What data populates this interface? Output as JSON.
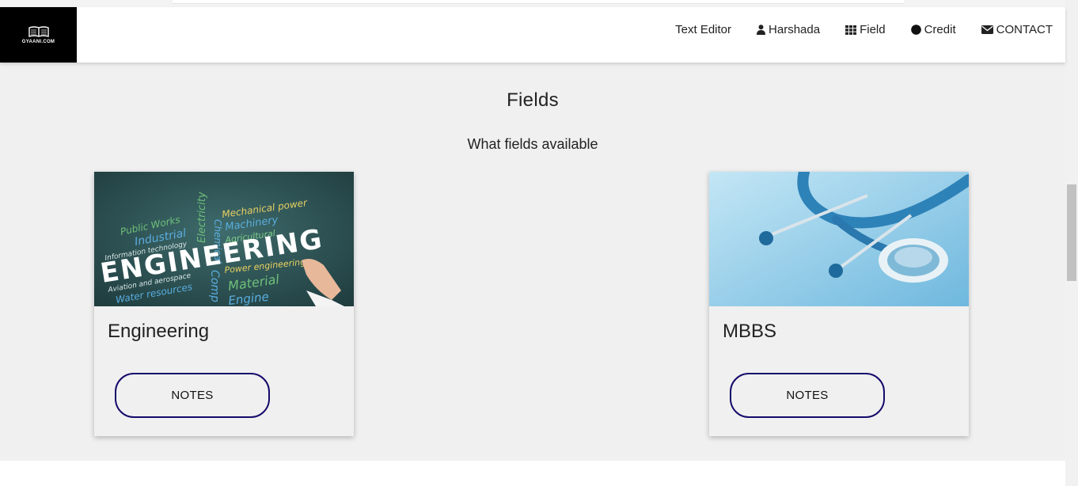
{
  "logo": {
    "text": "GYAANI.COM",
    "icon": "book-icon"
  },
  "nav": {
    "items": [
      {
        "label": "Text Editor",
        "icon": ""
      },
      {
        "label": "Harshada",
        "icon": "user-icon"
      },
      {
        "label": "Field",
        "icon": "grid-icon"
      },
      {
        "label": "Credit",
        "icon": "circle-icon"
      },
      {
        "label": "CONTACT",
        "icon": "envelope-icon"
      }
    ]
  },
  "section": {
    "title": "Fields",
    "subtitle": "What fields available"
  },
  "cards": [
    {
      "title": "Engineering",
      "button_label": "NOTES",
      "image": "engineering-image"
    },
    {
      "title": "MBBS",
      "button_label": "NOTES",
      "image": "stethoscope-image"
    }
  ],
  "colors": {
    "button_border": "#140a6a",
    "section_bg": "#f0f0f0",
    "logo_bg": "#000000"
  }
}
